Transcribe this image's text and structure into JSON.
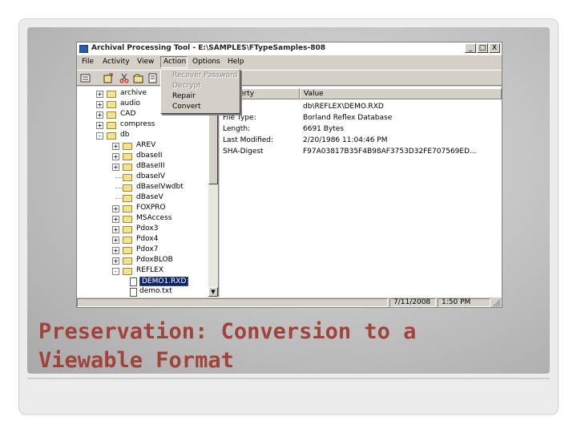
{
  "colors": {
    "caption": "#a0433b",
    "selection": "#0a246a",
    "window_chrome": "#d4d0c8"
  },
  "window": {
    "title": "Archival Processing Tool - E:\\SAMPLES\\FTypeSamples-808",
    "buttons": [
      "_",
      "□",
      "X"
    ]
  },
  "menu": {
    "items": [
      "File",
      "Activity",
      "View",
      "Action",
      "Options",
      "Help"
    ],
    "active": "Action"
  },
  "action_menu": {
    "items": [
      {
        "label": "Recover Password",
        "enabled": false
      },
      {
        "label": "Decrypt",
        "enabled": false
      },
      {
        "label": "Repair",
        "enabled": true
      },
      {
        "label": "Convert",
        "enabled": true
      }
    ]
  },
  "toolbar": {
    "hint": "y"
  },
  "tree": {
    "items": [
      {
        "label": "archive",
        "depth": 0,
        "expander": "+"
      },
      {
        "label": "audio",
        "depth": 0,
        "expander": "+"
      },
      {
        "label": "CAD",
        "depth": 0,
        "expander": "+"
      },
      {
        "label": "compress",
        "depth": 0,
        "expander": "+"
      },
      {
        "label": "db",
        "depth": 0,
        "expander": "-"
      },
      {
        "label": "AREV",
        "depth": 1,
        "expander": "+"
      },
      {
        "label": "dbaseII",
        "depth": 1,
        "expander": "+"
      },
      {
        "label": "dBaseIII",
        "depth": 1,
        "expander": "+"
      },
      {
        "label": "dbaseIV",
        "depth": 1,
        "expander": ""
      },
      {
        "label": "dBaseIVwdbt",
        "depth": 1,
        "expander": ""
      },
      {
        "label": "dBaseV",
        "depth": 1,
        "expander": ""
      },
      {
        "label": "FOXPRO",
        "depth": 1,
        "expander": "+"
      },
      {
        "label": "MSAccess",
        "depth": 1,
        "expander": "+"
      },
      {
        "label": "Pdox3",
        "depth": 1,
        "expander": "+"
      },
      {
        "label": "Pdox4",
        "depth": 1,
        "expander": "+"
      },
      {
        "label": "Pdox7",
        "depth": 1,
        "expander": "+"
      },
      {
        "label": "PdoxBLOB",
        "depth": 1,
        "expander": "+"
      },
      {
        "label": "REFLEX",
        "depth": 1,
        "expander": "-"
      },
      {
        "label": "DEMO1.RXD",
        "depth": 2,
        "expander": "",
        "file": true,
        "selected": true
      },
      {
        "label": "demo.txt",
        "depth": 2,
        "expander": "",
        "file": true
      }
    ]
  },
  "properties": {
    "columns": [
      "Property",
      "Value"
    ],
    "rows": [
      {
        "name": "",
        "value": "db\\REFLEX\\DEMO.RXD"
      },
      {
        "name": "File Type:",
        "value": "Borland Reflex Database"
      },
      {
        "name": "Length:",
        "value": "6691 Bytes"
      },
      {
        "name": "Last Modified:",
        "value": "2/20/1986 11:04:46 PM"
      },
      {
        "name": "SHA-Digest",
        "value": "F97A03817B35F4B98AF3753D32FE707569ED..."
      }
    ]
  },
  "status": {
    "date": "7/11/2008",
    "time": "1:50 PM"
  },
  "caption": {
    "line1": "Preservation: Conversion to a",
    "line2": "Viewable Format"
  }
}
